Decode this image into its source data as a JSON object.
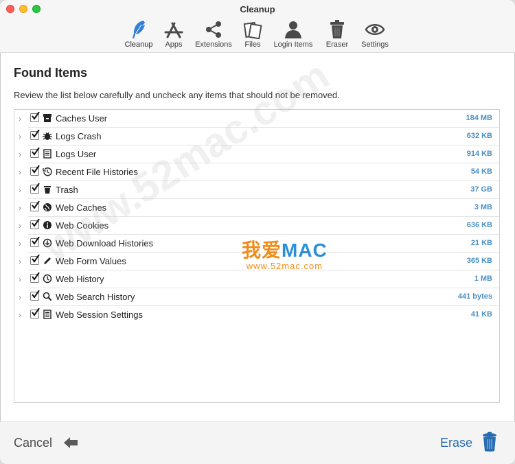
{
  "window": {
    "title": "Cleanup"
  },
  "toolbar": {
    "items": [
      {
        "label": "Cleanup",
        "icon": "feather-icon",
        "active": true
      },
      {
        "label": "Apps",
        "icon": "app-store-icon"
      },
      {
        "label": "Extensions",
        "icon": "share-icon"
      },
      {
        "label": "Files",
        "icon": "files-icon"
      },
      {
        "label": "Login Items",
        "icon": "user-icon"
      },
      {
        "label": "Eraser",
        "icon": "trash-icon"
      },
      {
        "label": "Settings",
        "icon": "eye-settings-icon"
      }
    ]
  },
  "main": {
    "heading": "Found Items",
    "description": "Review the list below carefully and uncheck any items that should not be removed.",
    "items": [
      {
        "label": "Caches User",
        "size": "184 MB",
        "checked": true,
        "icon": "archive-box-icon"
      },
      {
        "label": "Logs Crash",
        "size": "632 KB",
        "checked": true,
        "icon": "bug-icon"
      },
      {
        "label": "Logs User",
        "size": "914 KB",
        "checked": true,
        "icon": "document-icon"
      },
      {
        "label": "Recent File Histories",
        "size": "54 KB",
        "checked": true,
        "icon": "history-icon"
      },
      {
        "label": "Trash",
        "size": "37 GB",
        "checked": true,
        "icon": "trash-icon"
      },
      {
        "label": "Web Caches",
        "size": "3 MB",
        "checked": true,
        "icon": "globe-icon"
      },
      {
        "label": "Web Cookies",
        "size": "636 KB",
        "checked": true,
        "icon": "info-icon"
      },
      {
        "label": "Web Download Histories",
        "size": "21 KB",
        "checked": true,
        "icon": "download-icon"
      },
      {
        "label": "Web Form Values",
        "size": "365 KB",
        "checked": true,
        "icon": "pencil-icon"
      },
      {
        "label": "Web History",
        "size": "1 MB",
        "checked": true,
        "icon": "clock-icon"
      },
      {
        "label": "Web Search History",
        "size": "441 bytes",
        "checked": true,
        "icon": "magnifier-icon"
      },
      {
        "label": "Web Session Settings",
        "size": "41 KB",
        "checked": true,
        "icon": "settings-doc-icon"
      }
    ]
  },
  "footer": {
    "cancel_label": "Cancel",
    "erase_label": "Erase"
  },
  "watermark": {
    "brand_cn": "我爱",
    "brand_mac": "MAC",
    "url": "www.52mac.com",
    "diagonal": "www.52mac.com"
  },
  "colors": {
    "accent": "#2a6cb0",
    "size_text": "#4a8fc1",
    "feather": "#2f7fd6"
  }
}
